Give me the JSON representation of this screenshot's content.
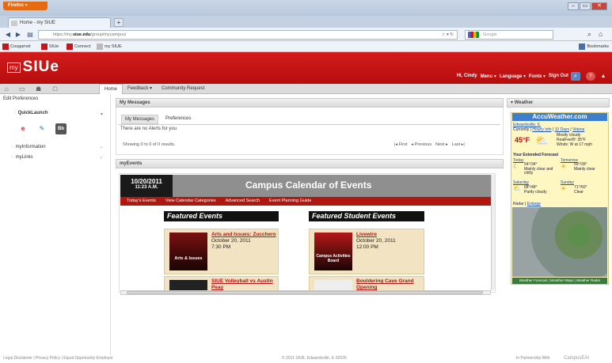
{
  "browser": {
    "app_button": "Firefox",
    "tab_title": "Home - my SIUE",
    "new_tab": "+",
    "url_prefix": "https://my.",
    "url_host": "siue.edu",
    "url_path": "/group/mycampus/",
    "search_engine": "Google",
    "bookmarks": [
      "Cougarnet",
      "SIUe",
      "Connect",
      "my SIUE"
    ],
    "bookmarks_menu": "Bookmarks"
  },
  "header": {
    "logo_my": "my",
    "logo_siue": "SIUe",
    "greeting": "Hi, Cindy",
    "menu": "Menu",
    "language": "Language",
    "fonts": "Fonts",
    "signout": "Sign Out"
  },
  "tabs": {
    "home": "Home",
    "feedback": "Feedback",
    "community": "Community Request"
  },
  "left": {
    "edit_prefs": "Edit Preferences",
    "quicklaunch": "QuickLaunch",
    "ql_icons": [
      "e",
      "✎",
      "Bb"
    ],
    "myinformation": "myInformation",
    "mylinks": "myLinks"
  },
  "messages": {
    "title": "My Messages",
    "tab_messages": "My Messages",
    "tab_prefs": "Preferences",
    "alerts": "There are no Alerts for you",
    "showing": "Showing 0 to 0 of 0 results.",
    "first": "First",
    "previous": "Previous",
    "next": "Next",
    "last": "Last"
  },
  "events": {
    "title": "myEvents",
    "date": "10/20/2011",
    "time": "11:23 A.M.",
    "cal_title": "Campus Calendar of Events",
    "nav": [
      "Today's Events",
      "View Calendar Categories",
      "Advanced Search",
      "Event Planning Guide"
    ],
    "featured_title": "Featured Events",
    "student_title": "Featured Student Events",
    "featured": [
      {
        "title": "Arts and Issues: Zucchero",
        "date": "October 20, 2011",
        "time": "7:30 PM",
        "img": "Arts & Issues"
      },
      {
        "title": "SIUE Volleyball vs Austin Peay",
        "date": "",
        "time": "",
        "img": ""
      }
    ],
    "student": [
      {
        "title": "Livewire",
        "date": "October 20, 2011",
        "time": "12:00 PM",
        "img": "Campus Activities Board"
      },
      {
        "title": "Bouldering Cave Grand Opening",
        "date": "",
        "time": "",
        "img": ""
      }
    ]
  },
  "weather": {
    "title": "Weather",
    "logo": "AccuWeather.com",
    "location": "Edwardsville, IL",
    "currently": "Currently |",
    "hourly": "Hourly Info",
    "tenday": "10 Days",
    "videos": "Videos",
    "temp": "45°F",
    "cond1": "Mostly cloudy",
    "cond2": "RealFeel®: 35°F",
    "cond3": "Winds: W at 17 mph",
    "extended": "Your Extended Forecast",
    "today": "Today",
    "today_temp": "54°/34°",
    "today_cond": "Mainly clear and chilly",
    "tomorrow": "Tomorrow",
    "tomorrow_temp": "59°/39°",
    "tomorrow_cond": "Mainly clear",
    "saturday": "Saturday",
    "saturday_temp": "68°/48°",
    "saturday_cond": "Partly cloudy",
    "sunday": "Sunday",
    "sunday_temp": "71°/50°",
    "sunday_cond": "Clear",
    "radar": "Radar |",
    "enlarge": "Enlarge",
    "footer_links": "Weather Forecast | Weather Maps | Weather Radar"
  },
  "footer": {
    "links": "Legal Disclaimer | Privacy Policy | Equal Opportunity Employer",
    "copyright": "© 2011 SIUE, Edwardsville, IL 62026",
    "partnership": "In Partnership With",
    "campus": "CampusEAI"
  },
  "colors": {
    "brand_red": "#c4161c",
    "event_link": "#b31212"
  }
}
